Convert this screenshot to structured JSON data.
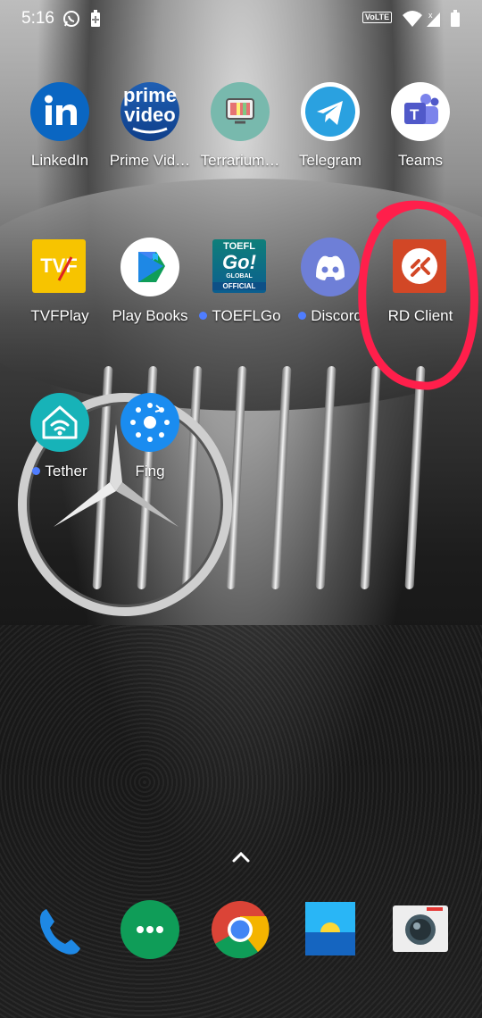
{
  "status_bar": {
    "time": "5:16",
    "network_badge": "VoLTE",
    "icons": [
      "whatsapp-icon",
      "battery-saver-icon",
      "wifi-icon",
      "signal-icon",
      "battery-icon"
    ]
  },
  "home_apps": [
    {
      "id": "linkedin",
      "label": "LinkedIn",
      "dot": false
    },
    {
      "id": "prime",
      "label": "Prime Vid…",
      "dot": false,
      "icon_text": "prime video"
    },
    {
      "id": "terrarium",
      "label": "Terrarium…",
      "dot": false
    },
    {
      "id": "telegram",
      "label": "Telegram",
      "dot": false
    },
    {
      "id": "teams",
      "label": "Teams",
      "dot": false
    },
    {
      "id": "tvfplay",
      "label": "TVFPlay",
      "dot": false,
      "icon_text": "TVF"
    },
    {
      "id": "playbooks",
      "label": "Play Books",
      "dot": false
    },
    {
      "id": "toeflgo",
      "label": "TOEFLGo",
      "dot": true,
      "icon_text": "TOEFL Go! GLOBAL OFFICIAL"
    },
    {
      "id": "discord",
      "label": "Discord",
      "dot": true
    },
    {
      "id": "rdclient",
      "label": "RD Client",
      "dot": false
    },
    {
      "id": "tether",
      "label": "Tether",
      "dot": true
    },
    {
      "id": "fing",
      "label": "Fing",
      "dot": false
    }
  ],
  "dock_apps": [
    "phone",
    "hangouts",
    "chrome",
    "files",
    "camera"
  ],
  "icon_text": {
    "prime_line1": "prime",
    "prime_line2": "video",
    "tvf": "TVF",
    "toefl": "TOEFL",
    "go": "Go!",
    "global": "GLOBAL",
    "official": "OFFICIAL"
  },
  "colors": {
    "annotation": "#ff1f4b",
    "linkedin": "#0a66c2",
    "telegram": "#2aa1e0",
    "teams": "#5059c9",
    "discord": "#5865f2",
    "rd": "#d24726",
    "tether": "#17b3b8",
    "fing": "#1a8cf0"
  }
}
